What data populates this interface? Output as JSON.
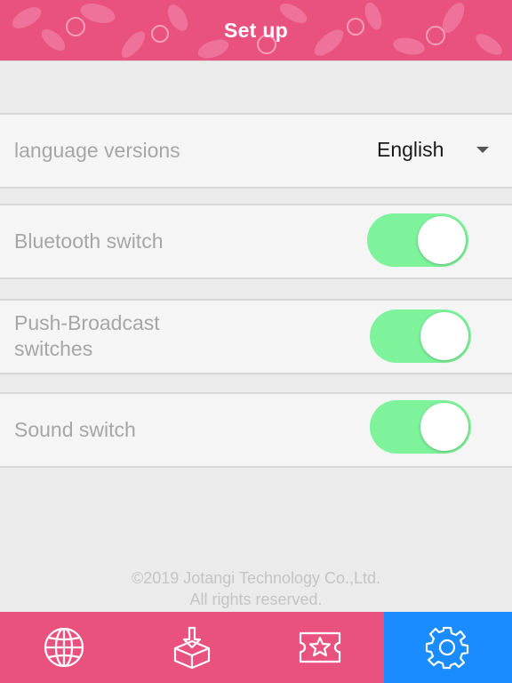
{
  "header": {
    "title": "Set up"
  },
  "settings": {
    "language": {
      "label": "language versions",
      "value": "English"
    },
    "bluetooth": {
      "label": "Bluetooth switch",
      "on": true
    },
    "push_broadcast": {
      "label_line1": "Push-Broadcast",
      "label_line2": "switches",
      "on": true
    },
    "sound": {
      "label": "Sound switch",
      "on": true
    }
  },
  "footer": {
    "copyright_line1": "©2019 Jotangi Technology Co.,Ltd.",
    "copyright_line2": "All rights reserved."
  },
  "tabbar": {
    "tabs": [
      {
        "icon": "globe-icon",
        "active": false
      },
      {
        "icon": "download-box-icon",
        "active": false
      },
      {
        "icon": "star-ticket-icon",
        "active": false
      },
      {
        "icon": "gear-icon",
        "active": true
      }
    ]
  },
  "colors": {
    "header_pink": "#e9527f",
    "toggle_green": "#7ef39b",
    "active_tab_blue": "#1a8cff"
  }
}
